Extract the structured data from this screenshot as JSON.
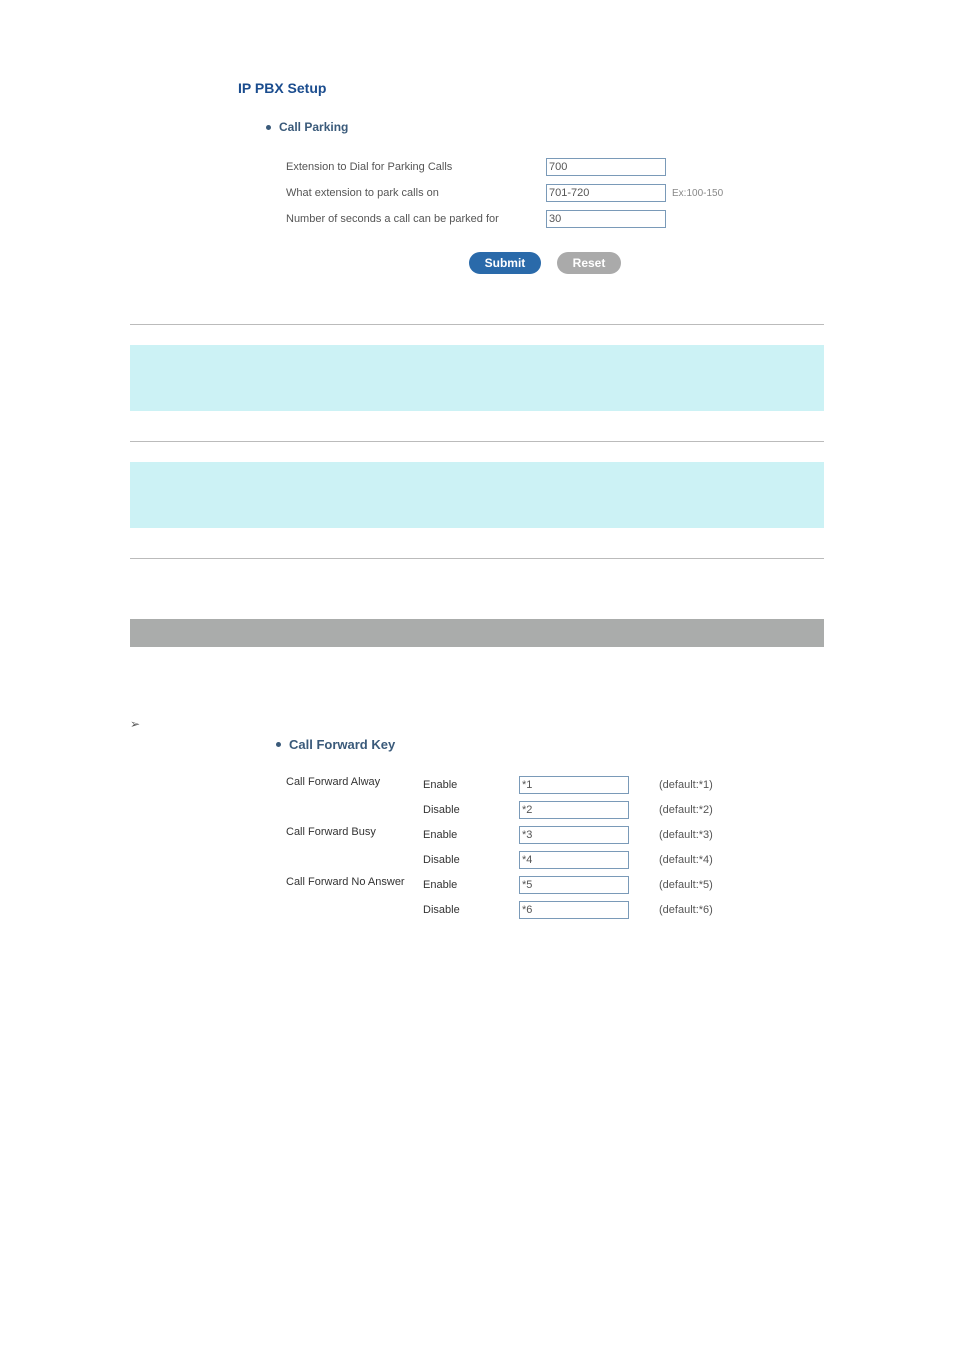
{
  "page_title": "IP PBX Setup",
  "call_parking": {
    "title": "Call Parking",
    "rows": {
      "ext_dial_label": "Extension to Dial for Parking Calls",
      "ext_dial_value": "700",
      "ext_park_label": "What extension to park calls on",
      "ext_park_value": "701-720",
      "ext_park_hint": "Ex:100-150",
      "seconds_label": "Number of seconds a call can be parked for",
      "seconds_value": "30"
    },
    "submit_label": "Submit",
    "reset_label": "Reset"
  },
  "call_forward_key": {
    "title": "Call Forward Key",
    "groups": [
      {
        "label": "Call Forward Alway",
        "rows": [
          {
            "ed": "Enable",
            "value": "*1",
            "default": "(default:*1)"
          },
          {
            "ed": "Disable",
            "value": "*2",
            "default": "(default:*2)"
          }
        ]
      },
      {
        "label": "Call Forward Busy",
        "rows": [
          {
            "ed": "Enable",
            "value": "*3",
            "default": "(default:*3)"
          },
          {
            "ed": "Disable",
            "value": "*4",
            "default": "(default:*4)"
          }
        ]
      },
      {
        "label": "Call Forward No Answer",
        "rows": [
          {
            "ed": "Enable",
            "value": "*5",
            "default": "(default:*5)"
          },
          {
            "ed": "Disable",
            "value": "*6",
            "default": "(default:*6)"
          }
        ]
      }
    ]
  }
}
